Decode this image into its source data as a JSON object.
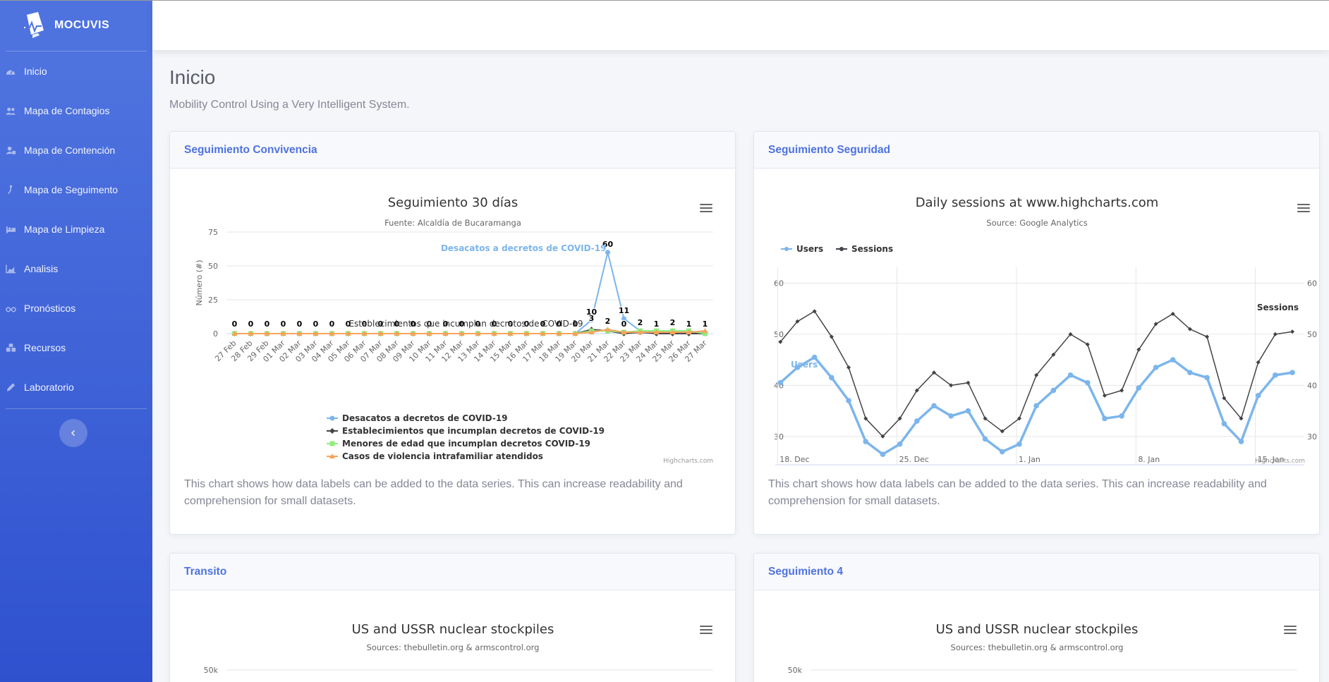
{
  "app": {
    "name": "MOCUVIS"
  },
  "sidebar": {
    "items": [
      {
        "label": "Inicio",
        "icon": "dashboard-icon"
      },
      {
        "label": "Mapa de Contagios",
        "icon": "users-icon"
      },
      {
        "label": "Mapa de Contención",
        "icon": "user-lock-icon"
      },
      {
        "label": "Mapa de Seguimento",
        "icon": "walking-icon"
      },
      {
        "label": "Mapa de Limpieza",
        "icon": "bed-icon"
      },
      {
        "label": "Analisis",
        "icon": "chart-area-icon"
      },
      {
        "label": "Pronósticos",
        "icon": "glasses-icon"
      },
      {
        "label": "Recursos",
        "icon": "cubes-icon"
      },
      {
        "label": "Laboratorio",
        "icon": "pen-icon"
      }
    ]
  },
  "page": {
    "title": "Inicio",
    "subtitle": "Mobility Control Using a Very Intelligent System."
  },
  "cards": [
    {
      "title": "Seguimiento Convivencia",
      "text": "This chart shows how data labels can be added to the data series. This can increase readability and comprehension for small datasets."
    },
    {
      "title": "Seguimiento Seguridad",
      "text": "This chart shows how data labels can be added to the data series. This can increase readability and comprehension for small datasets."
    },
    {
      "title": "Transito"
    },
    {
      "title": "Seguimiento 4"
    }
  ],
  "chart_data": [
    {
      "type": "line",
      "title": "Seguimiento 30 días",
      "subtitle": "Fuente: Alcaldía de Bucaramanga",
      "ylabel": "Número (#)",
      "ylim": [
        0,
        75
      ],
      "yticks": [
        0,
        25,
        50,
        75
      ],
      "credits": "Highcharts.com",
      "legend": "bottom",
      "categories": [
        "27 Feb",
        "28 Feb",
        "29 Feb",
        "01 Mar",
        "02 Mar",
        "03 Mar",
        "04 Mar",
        "05 Mar",
        "06 Mar",
        "07 Mar",
        "08 Mar",
        "09 Mar",
        "10 Mar",
        "11 Mar",
        "12 Mar",
        "13 Mar",
        "14 Mar",
        "15 Mar",
        "16 Mar",
        "17 Mar",
        "18 Mar",
        "19 Mar",
        "20 Mar",
        "21 Mar",
        "22 Mar",
        "23 Mar",
        "24 Mar",
        "25 Mar",
        "26 Mar",
        "27 Mar"
      ],
      "series": [
        {
          "name": "Desacatos a decretos de COVID-19",
          "color": "#7cb5ec",
          "marker": "circle",
          "values": [
            0,
            0,
            0,
            0,
            0,
            0,
            0,
            0,
            0,
            0,
            0,
            0,
            0,
            0,
            0,
            0,
            0,
            0,
            0,
            0,
            0,
            0,
            10,
            60,
            11,
            2,
            1,
            2,
            1,
            1
          ]
        },
        {
          "name": "Establecimientos que incumplan decretos de COVID-19",
          "color": "#434348",
          "marker": "diamond",
          "values": [
            0,
            0,
            0,
            0,
            0,
            0,
            0,
            0,
            0,
            0,
            0,
            0,
            0,
            0,
            0,
            0,
            0,
            0,
            0,
            0,
            0,
            0,
            3,
            2,
            0,
            1,
            0,
            0,
            0,
            0
          ]
        },
        {
          "name": "Menores de edad que incumplan decretos COVID-19",
          "color": "#90ed7d",
          "marker": "square",
          "values": [
            0,
            0,
            0,
            0,
            0,
            0,
            0,
            0,
            0,
            0,
            0,
            0,
            0,
            0,
            0,
            0,
            0,
            0,
            0,
            0,
            0,
            0,
            2,
            2,
            1,
            2,
            2,
            2,
            2,
            0
          ]
        },
        {
          "name": "Casos de violencia intrafamiliar atendidos",
          "color": "#f7a35c",
          "marker": "triangle",
          "values": [
            0,
            0,
            0,
            0,
            0,
            0,
            0,
            0,
            0,
            0,
            0,
            0,
            0,
            0,
            0,
            0,
            0,
            0,
            0,
            0,
            0,
            0,
            1,
            3,
            1,
            1,
            1,
            1,
            1,
            2
          ]
        }
      ],
      "annotations": [
        {
          "text": "Desacatos a decretos de COVID-19",
          "series": 0
        },
        {
          "text": "Establecimientos que incumplan decretos de COVID-19",
          "series": 1
        }
      ]
    },
    {
      "type": "line",
      "title": "Daily sessions at www.highcharts.com",
      "subtitle": "Source: Google Analytics",
      "ylim": [
        25,
        62
      ],
      "yticks": [
        30,
        40,
        50,
        60
      ],
      "xticks": [
        "18. Dec",
        "25. Dec",
        "1. Jan",
        "8. Jan",
        "15. Jan"
      ],
      "credits": "Highcharts.com",
      "legend": "top-left",
      "series": [
        {
          "name": "Users",
          "color": "#7cb5ec",
          "values": [
            40.5,
            43.5,
            45.5,
            41.5,
            37,
            29,
            26.5,
            28.5,
            33,
            36,
            34,
            35,
            29.5,
            27,
            28.5,
            36,
            39,
            42,
            40.5,
            33.5,
            34,
            39.5,
            43.5,
            45,
            42.5,
            41.5,
            32.5,
            29,
            38,
            42,
            42.5
          ]
        },
        {
          "name": "Sessions",
          "color": "#434348",
          "values": [
            48.5,
            52.5,
            54.5,
            49.5,
            43.5,
            33.5,
            30,
            33.5,
            39,
            42.5,
            40,
            40.5,
            33.5,
            31,
            33.5,
            42,
            46,
            50,
            48,
            38,
            39,
            47,
            52,
            54,
            51,
            49.5,
            37.5,
            33.5,
            44.5,
            50,
            50.5
          ]
        }
      ]
    },
    {
      "type": "area",
      "title": "US and USSR nuclear stockpiles",
      "subtitle": "Sources: thebulletin.org & armscontrol.org",
      "yticks": [
        "50k"
      ]
    },
    {
      "type": "area",
      "title": "US and USSR nuclear stockpiles",
      "subtitle": "Sources: thebulletin.org & armscontrol.org",
      "yticks": [
        "50k"
      ]
    }
  ]
}
